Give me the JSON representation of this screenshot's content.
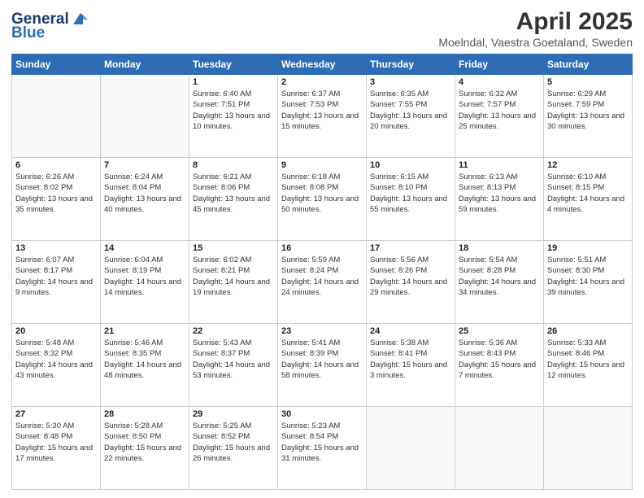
{
  "logo": {
    "line1": "General",
    "line2": "Blue"
  },
  "title": "April 2025",
  "subtitle": "Moelndal, Vaestra Goetaland, Sweden",
  "days_of_week": [
    "Sunday",
    "Monday",
    "Tuesday",
    "Wednesday",
    "Thursday",
    "Friday",
    "Saturday"
  ],
  "weeks": [
    [
      {
        "day": "",
        "detail": ""
      },
      {
        "day": "",
        "detail": ""
      },
      {
        "day": "1",
        "detail": "Sunrise: 6:40 AM\nSunset: 7:51 PM\nDaylight: 13 hours and 10 minutes."
      },
      {
        "day": "2",
        "detail": "Sunrise: 6:37 AM\nSunset: 7:53 PM\nDaylight: 13 hours and 15 minutes."
      },
      {
        "day": "3",
        "detail": "Sunrise: 6:35 AM\nSunset: 7:55 PM\nDaylight: 13 hours and 20 minutes."
      },
      {
        "day": "4",
        "detail": "Sunrise: 6:32 AM\nSunset: 7:57 PM\nDaylight: 13 hours and 25 minutes."
      },
      {
        "day": "5",
        "detail": "Sunrise: 6:29 AM\nSunset: 7:59 PM\nDaylight: 13 hours and 30 minutes."
      }
    ],
    [
      {
        "day": "6",
        "detail": "Sunrise: 6:26 AM\nSunset: 8:02 PM\nDaylight: 13 hours and 35 minutes."
      },
      {
        "day": "7",
        "detail": "Sunrise: 6:24 AM\nSunset: 8:04 PM\nDaylight: 13 hours and 40 minutes."
      },
      {
        "day": "8",
        "detail": "Sunrise: 6:21 AM\nSunset: 8:06 PM\nDaylight: 13 hours and 45 minutes."
      },
      {
        "day": "9",
        "detail": "Sunrise: 6:18 AM\nSunset: 8:08 PM\nDaylight: 13 hours and 50 minutes."
      },
      {
        "day": "10",
        "detail": "Sunrise: 6:15 AM\nSunset: 8:10 PM\nDaylight: 13 hours and 55 minutes."
      },
      {
        "day": "11",
        "detail": "Sunrise: 6:13 AM\nSunset: 8:13 PM\nDaylight: 13 hours and 59 minutes."
      },
      {
        "day": "12",
        "detail": "Sunrise: 6:10 AM\nSunset: 8:15 PM\nDaylight: 14 hours and 4 minutes."
      }
    ],
    [
      {
        "day": "13",
        "detail": "Sunrise: 6:07 AM\nSunset: 8:17 PM\nDaylight: 14 hours and 9 minutes."
      },
      {
        "day": "14",
        "detail": "Sunrise: 6:04 AM\nSunset: 8:19 PM\nDaylight: 14 hours and 14 minutes."
      },
      {
        "day": "15",
        "detail": "Sunrise: 6:02 AM\nSunset: 8:21 PM\nDaylight: 14 hours and 19 minutes."
      },
      {
        "day": "16",
        "detail": "Sunrise: 5:59 AM\nSunset: 8:24 PM\nDaylight: 14 hours and 24 minutes."
      },
      {
        "day": "17",
        "detail": "Sunrise: 5:56 AM\nSunset: 8:26 PM\nDaylight: 14 hours and 29 minutes."
      },
      {
        "day": "18",
        "detail": "Sunrise: 5:54 AM\nSunset: 8:28 PM\nDaylight: 14 hours and 34 minutes."
      },
      {
        "day": "19",
        "detail": "Sunrise: 5:51 AM\nSunset: 8:30 PM\nDaylight: 14 hours and 39 minutes."
      }
    ],
    [
      {
        "day": "20",
        "detail": "Sunrise: 5:48 AM\nSunset: 8:32 PM\nDaylight: 14 hours and 43 minutes."
      },
      {
        "day": "21",
        "detail": "Sunrise: 5:46 AM\nSunset: 8:35 PM\nDaylight: 14 hours and 48 minutes."
      },
      {
        "day": "22",
        "detail": "Sunrise: 5:43 AM\nSunset: 8:37 PM\nDaylight: 14 hours and 53 minutes."
      },
      {
        "day": "23",
        "detail": "Sunrise: 5:41 AM\nSunset: 8:39 PM\nDaylight: 14 hours and 58 minutes."
      },
      {
        "day": "24",
        "detail": "Sunrise: 5:38 AM\nSunset: 8:41 PM\nDaylight: 15 hours and 3 minutes."
      },
      {
        "day": "25",
        "detail": "Sunrise: 5:36 AM\nSunset: 8:43 PM\nDaylight: 15 hours and 7 minutes."
      },
      {
        "day": "26",
        "detail": "Sunrise: 5:33 AM\nSunset: 8:46 PM\nDaylight: 15 hours and 12 minutes."
      }
    ],
    [
      {
        "day": "27",
        "detail": "Sunrise: 5:30 AM\nSunset: 8:48 PM\nDaylight: 15 hours and 17 minutes."
      },
      {
        "day": "28",
        "detail": "Sunrise: 5:28 AM\nSunset: 8:50 PM\nDaylight: 15 hours and 22 minutes."
      },
      {
        "day": "29",
        "detail": "Sunrise: 5:25 AM\nSunset: 8:52 PM\nDaylight: 15 hours and 26 minutes."
      },
      {
        "day": "30",
        "detail": "Sunrise: 5:23 AM\nSunset: 8:54 PM\nDaylight: 15 hours and 31 minutes."
      },
      {
        "day": "",
        "detail": ""
      },
      {
        "day": "",
        "detail": ""
      },
      {
        "day": "",
        "detail": ""
      }
    ]
  ]
}
